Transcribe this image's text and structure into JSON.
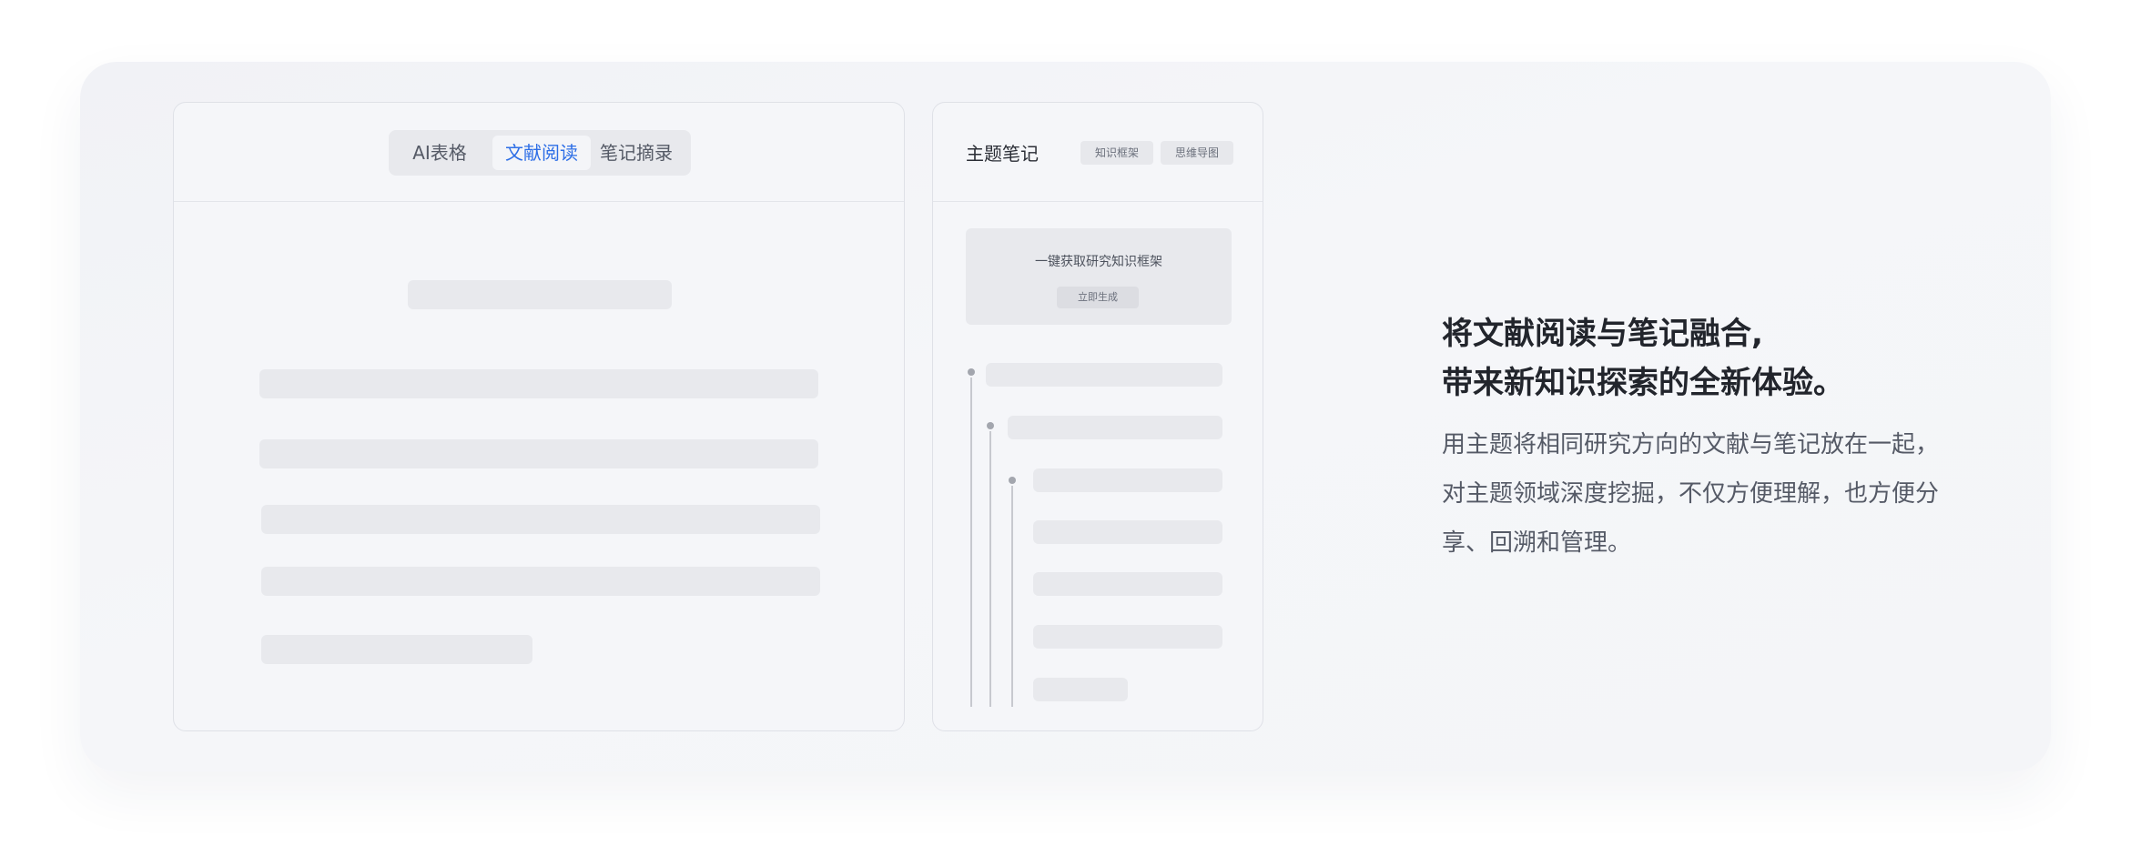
{
  "reader_panel": {
    "tabs": [
      {
        "label": "AI表格",
        "active": false
      },
      {
        "label": "文献阅读",
        "active": true
      },
      {
        "label": "笔记摘录",
        "active": false
      }
    ]
  },
  "notes_panel": {
    "title": "主题笔记",
    "chips": [
      "知识框架",
      "思维导图"
    ],
    "generate_prompt": "一键获取研究知识框架",
    "generate_button": "立即生成"
  },
  "copy": {
    "headline_line1": "将文献阅读与笔记融合,",
    "headline_line2": "带来新知识探索的全新体验。",
    "body": "用主题将相同研究方向的文献与笔记放在一起，对主题领域深度挖掘，不仅方便理解，也方便分享、回溯和管理。"
  },
  "colors": {
    "accent": "#2d6ee6",
    "card_bg": "#f4f5f8",
    "placeholder": "#e8e9ed",
    "headline": "#22252c",
    "body": "#555a66"
  }
}
